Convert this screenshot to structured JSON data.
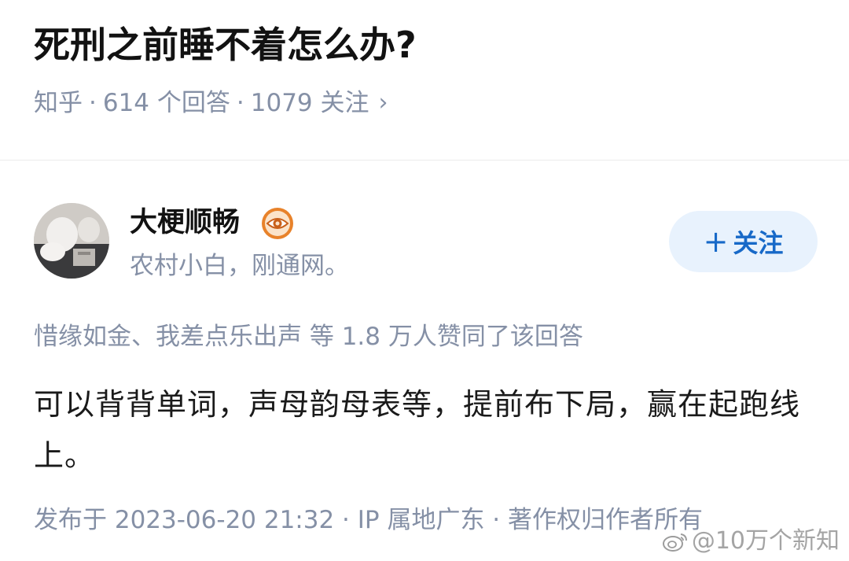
{
  "question": {
    "title": "死刑之前睡不着怎么办?",
    "source": "知乎",
    "separator": "·",
    "answer_count": "614 个回答",
    "follow_count": "1079 关注",
    "chevron": "›"
  },
  "author": {
    "name": "大梗顺畅",
    "bio": "农村小白，刚通网。",
    "badge_icon": "eye-badge-icon",
    "follow_button_label": "关注",
    "follow_button_plus": "+"
  },
  "answer": {
    "upvote_text": "惜缘如金、我差点乐出声 等 1.8 万人赞同了该回答",
    "body": "可以背背单词，声母韵母表等，提前布下局，赢在起跑线上。",
    "footer": "发布于 2023-06-20 21:32 · IP 属地广东 · 著作权归作者所有"
  },
  "watermark": {
    "text": "@10万个新知",
    "icon": "weibo-icon"
  },
  "colors": {
    "accent": "#1769c8",
    "follow_bg": "#e8f2fd",
    "muted_text": "#8590a6",
    "badge": "#e8822a"
  }
}
